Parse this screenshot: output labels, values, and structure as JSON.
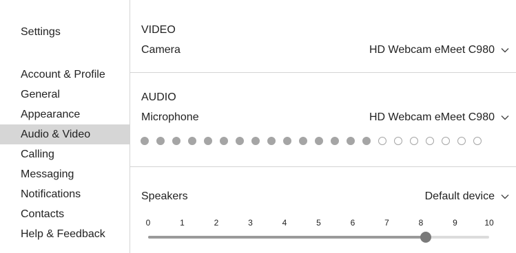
{
  "sidebar": {
    "title": "Settings",
    "items": [
      {
        "label": "Account & Profile",
        "active": false
      },
      {
        "label": "General",
        "active": false
      },
      {
        "label": "Appearance",
        "active": false
      },
      {
        "label": "Audio & Video",
        "active": true
      },
      {
        "label": "Calling",
        "active": false
      },
      {
        "label": "Messaging",
        "active": false
      },
      {
        "label": "Notifications",
        "active": false
      },
      {
        "label": "Contacts",
        "active": false
      },
      {
        "label": "Help & Feedback",
        "active": false
      }
    ]
  },
  "video": {
    "section_label": "VIDEO",
    "camera_label": "Camera",
    "camera_value": "HD Webcam eMeet C980"
  },
  "audio": {
    "section_label": "AUDIO",
    "microphone_label": "Microphone",
    "microphone_value": "HD Webcam eMeet C980",
    "mic_level": {
      "active": 15,
      "total": 22
    }
  },
  "speakers": {
    "label": "Speakers",
    "value": "Default device",
    "volume_ticks": [
      "0",
      "1",
      "2",
      "3",
      "4",
      "5",
      "6",
      "7",
      "8",
      "9",
      "10"
    ],
    "volume": 8,
    "volume_max": 10
  },
  "colors": {
    "active_nav_bg": "#d6d6d6",
    "divider": "#d4d4d4",
    "level_dot": "#a5a5a5",
    "slider_fill": "#9a9a9a",
    "slider_thumb": "#7a7a7a"
  },
  "icons": {
    "dropdown": "chevron-down-icon"
  }
}
